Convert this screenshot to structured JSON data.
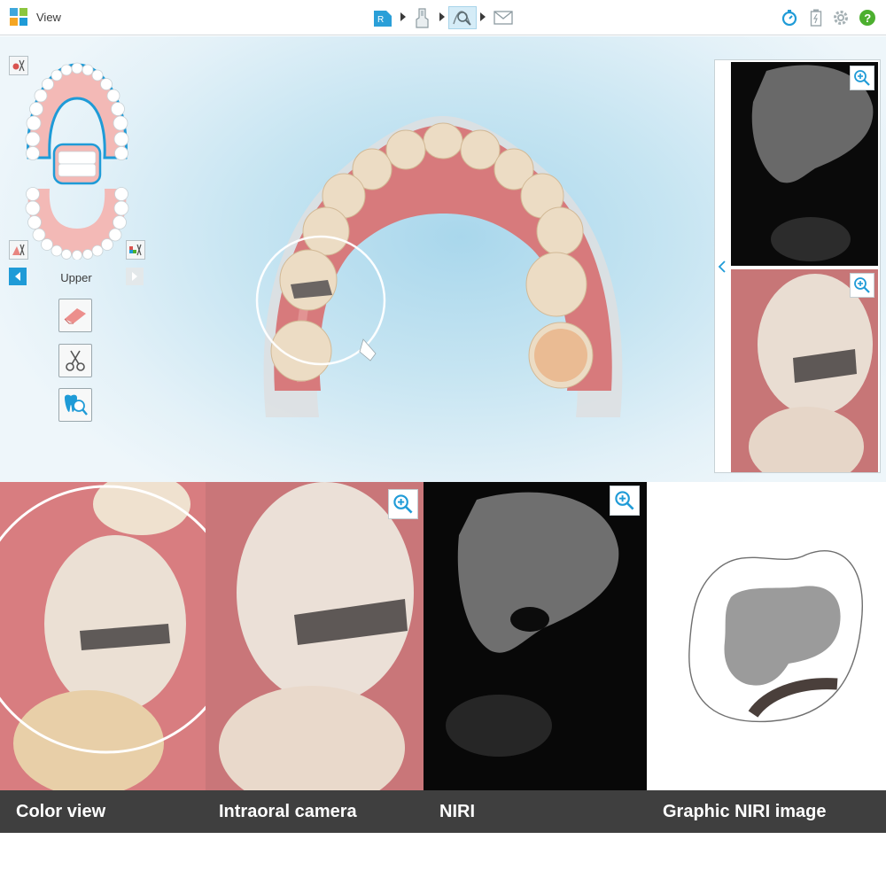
{
  "header": {
    "title": "View",
    "workflow_step_rx": "R",
    "workflow_steps": [
      "rx-step-icon",
      "scan-step-icon",
      "view-step-icon",
      "send-step-icon"
    ],
    "active_step": "view-step-icon",
    "right_icons": [
      "timer-icon",
      "battery-icon",
      "gear-icon",
      "help-icon"
    ],
    "help_glyph": "?"
  },
  "left_panel": {
    "jaw_label": "Upper",
    "tools": [
      "eraser-icon",
      "trim-scissors-icon",
      "tooth-zoom-icon"
    ]
  },
  "right_panel": {
    "images": [
      "NIRI thumbnail",
      "Intraoral camera thumbnail"
    ]
  },
  "bottom": {
    "captions": [
      "Color view",
      "Intraoral camera",
      "NIRI",
      "Graphic NIRI image"
    ]
  },
  "colors": {
    "accent": "#1f9bd7",
    "help_green": "#4caf2f",
    "caption_bg": "#3f3f3f",
    "gum": "#d77a7c",
    "tooth": "#ecdcc4",
    "filling": "#6b6563"
  }
}
